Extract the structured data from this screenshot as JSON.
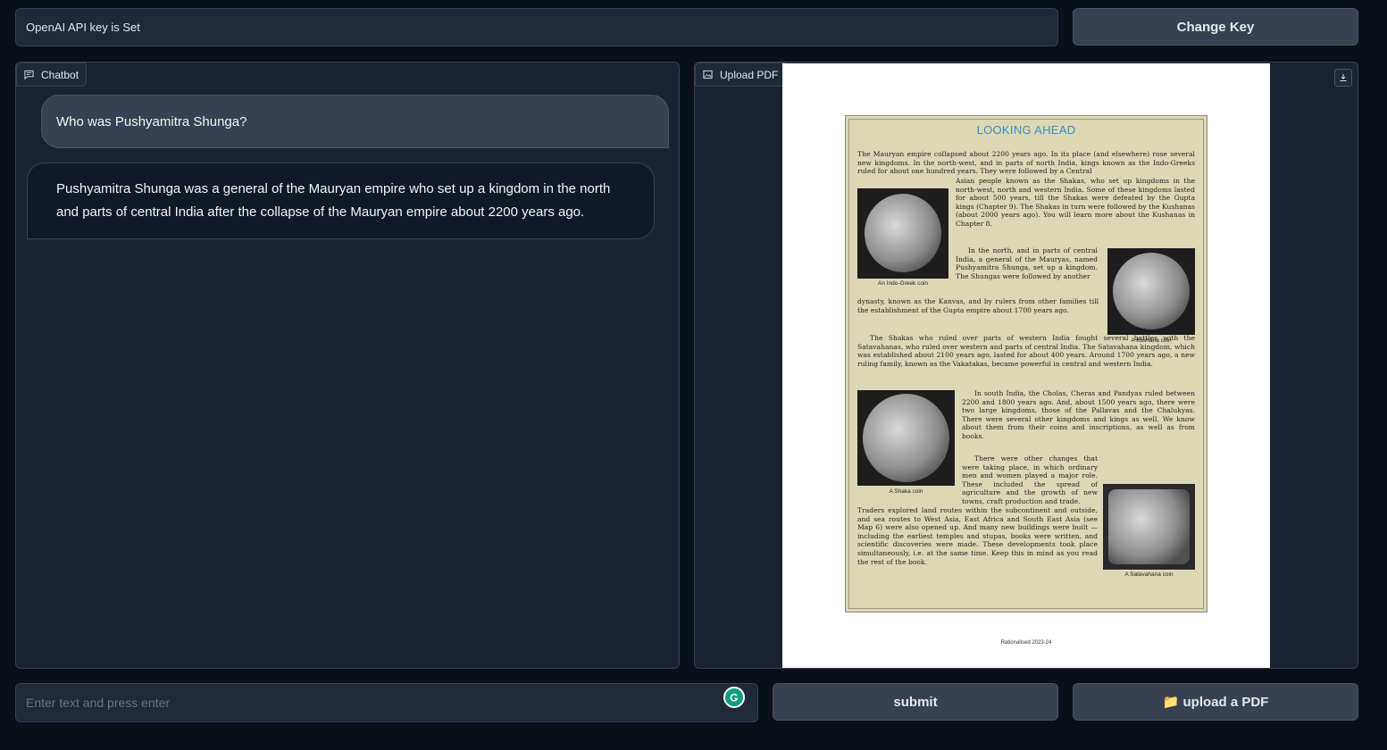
{
  "header": {
    "key_status": "OpenAI API key is Set",
    "change_key_label": "Change Key"
  },
  "chatbot": {
    "label": "Chatbot",
    "messages": [
      {
        "role": "user",
        "text": "Who was Pushyamitra Shunga?"
      },
      {
        "role": "bot",
        "text": "Pushyamitra Shunga was a general of the Mauryan empire who set up a kingdom in the north and parts of central India after the collapse of the Mauryan empire about 2200 years ago."
      }
    ]
  },
  "pdf_viewer": {
    "label": "Upload PDF",
    "page": {
      "heading": "LOOKING AHEAD",
      "para1": "The Mauryan empire collapsed about 2200 years ago. In its place (and elsewhere) rose several new kingdoms. In the north-west, and in parts of north India, kings known as the Indo-Greeks ruled for about one hundred years. They were followed by a Central",
      "para1b": "Asian people known as the Shakas, who set up kingdoms in the north-west, north and western India. Some of these kingdoms lasted for about 500 years, till the Shakas were defeated by the Gupta kings (Chapter 9). The Shakas in turn were followed by the Kushanas (about 2000 years ago). You will learn more about the Kushanas in Chapter 8.",
      "para2a": "In the north, and in parts of central India, a general of the Mauryas, named Pushyamitra Shunga, set up a kingdom. The Shungas were followed by another",
      "para2b": "dynasty, known as the Kanvas, and by rulers from other families till the establishment of the Gupta empire about 1700 years ago.",
      "para3": "The Shakas who ruled over parts of western India fought several battles with the Satavahanas, who ruled over western and parts of central India. The Satavahana kingdom, which was established about 2100 years ago, lasted for about 400 years. Around 1700 years ago, a new ruling family, known as the Vakatakas, became powerful in central and western India.",
      "para4": "In south India, the Cholas, Cheras and Pandyas ruled between 2200 and 1800 years ago. And, about 1500 years ago, there were two large kingdoms, those of the Pallavas and the Chalukyas. There were several other kingdoms and kings as well. We know about them from their coins and inscriptions, as well as from books.",
      "para5a": "There were other changes that were taking place, in which ordinary men and women played a major role. These included the spread of agriculture and the growth of new towns, craft production and trade.",
      "para5b": "Traders explored land routes within the subcontinent and outside, and sea routes to West Asia, East Africa and South East Asia (see Map 6) were also opened up. And many new buildings were built — including the earliest temples and stupas, books were written, and scientific discoveries were made. These developments took place simultaneously, i.e. at the same time. Keep this in mind as you read the rest of the book.",
      "captions": [
        "An Indo-Greek coin",
        "A Kushana coin",
        "A Shaka coin",
        "A Satavahana coin"
      ],
      "footer": "Rationalised 2023-24"
    }
  },
  "footer_bar": {
    "input_placeholder": "Enter text and press enter",
    "submit_label": "submit",
    "upload_label": "📁 upload a PDF"
  }
}
